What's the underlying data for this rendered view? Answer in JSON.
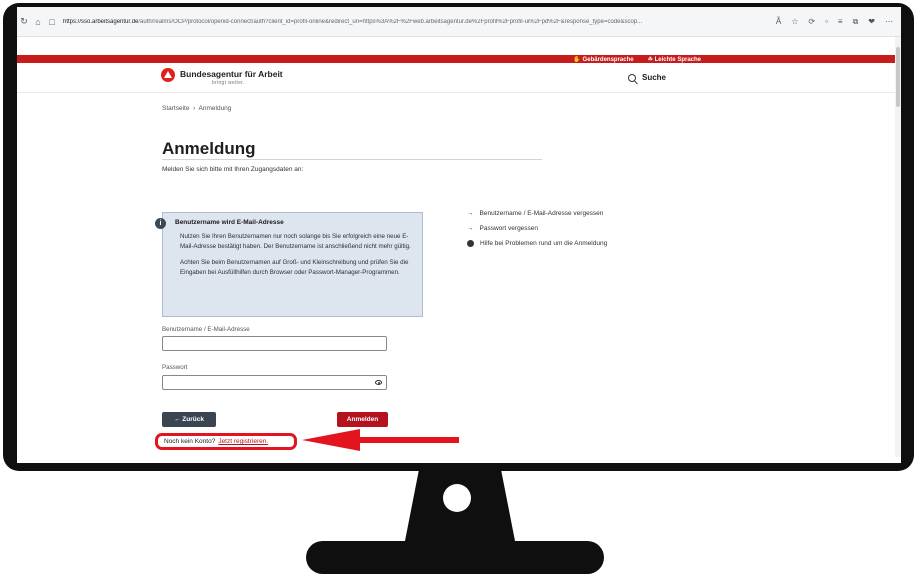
{
  "browser": {
    "url_host": "https://sso.arbeitsagentur.de",
    "url_path": "/auth/realms/OCP/protocol/openid-connect/auth?client_id=profil-online&redirect_uri=https%3A%2F%2Fweb.arbeitsagentur.de%2Fprofil%2Fprofil-ui%2Fpd%2F&response_type=code&scop...",
    "icons": [
      "Ã",
      "☆",
      "⟳",
      "▫",
      "≡",
      "⧉",
      "❤",
      "⋯"
    ]
  },
  "service_bar": {
    "sign_language": "✋ Gebärdensprache",
    "easy_language": "☘ Leichte Sprache"
  },
  "header": {
    "brand": "Bundesagentur für Arbeit",
    "slogan": "bringt weiter.",
    "search_label": "Suche"
  },
  "breadcrumb": {
    "home": "Startseite",
    "separator": "›",
    "current": "Anmeldung"
  },
  "page": {
    "title": "Anmeldung",
    "subtitle": "Melden Sie sich bitte mit Ihren Zugangsdaten an:"
  },
  "info_box": {
    "title": "Benutzername wird E-Mail-Adresse",
    "paragraph1": "Nutzen Sie Ihren Benutzernamen nur noch solange bis Sie erfolgreich eine neue E-Mail-Adresse bestätigt haben. Der Benutzername ist anschließend nicht mehr gültig.",
    "paragraph2": "Achten Sie beim Benutzernamen auf Groß- und Kleinschreibung und prüfen Sie die Eingaben bei Ausfüllhilfen durch Browser oder Passwort-Manager-Programmen."
  },
  "help_links": {
    "forgot_username": "Benutzername / E-Mail-Adresse vergessen",
    "forgot_password": "Passwort vergessen",
    "help": "Hilfe bei Problemen rund um die Anmeldung"
  },
  "form": {
    "username_label": "Benutzername / E-Mail-Adresse",
    "username_value": "",
    "password_label": "Passwort",
    "password_value": "",
    "back_label": "← Zurück",
    "login_label": "Anmelden"
  },
  "register": {
    "question": "Noch kein Konto?",
    "link": "Jetzt registrieren."
  },
  "annotation_color": "#e3141d",
  "accent_color": "#b4121f"
}
